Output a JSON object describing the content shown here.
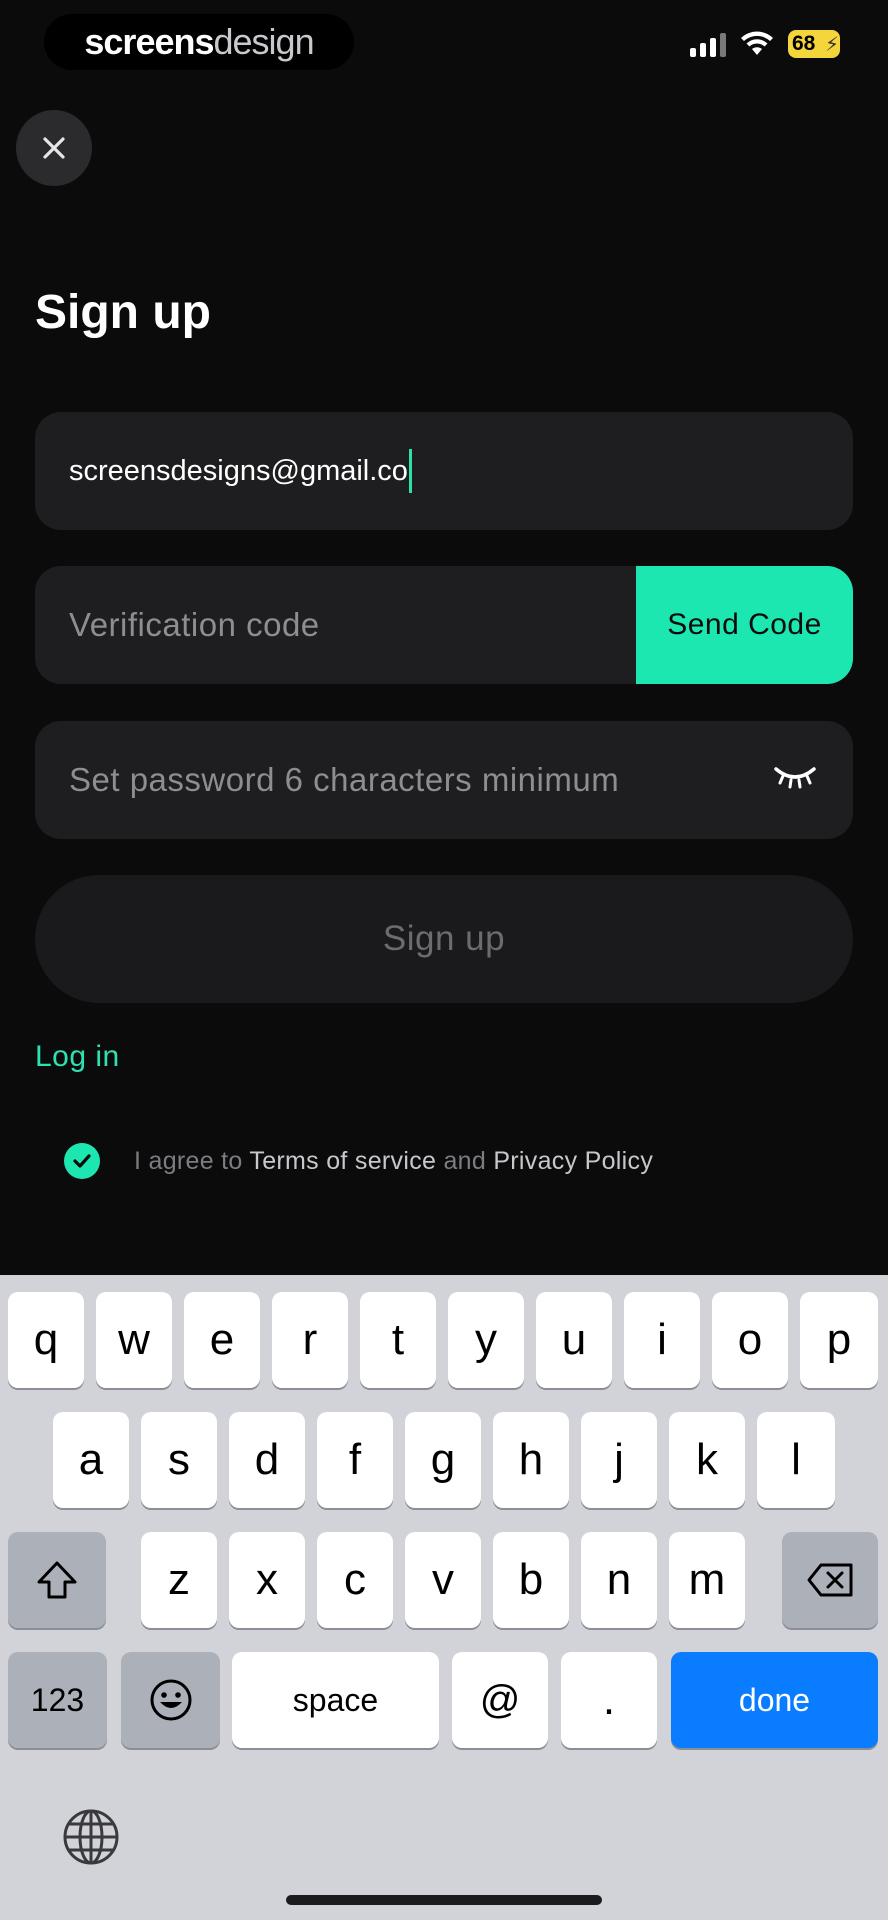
{
  "status_bar": {
    "brand_part1": "screens",
    "brand_part2": "design",
    "battery": "68"
  },
  "header": {
    "title": "Sign up",
    "close_icon": "close-icon"
  },
  "form": {
    "email_value": "screensdesigns@gmail.co",
    "verification_placeholder": "Verification code",
    "send_code_label": "Send Code",
    "password_placeholder": "Set password 6 characters minimum",
    "password_toggle_icon": "eye-closed-icon",
    "submit_label": "Sign up"
  },
  "login_link": "Log in",
  "agreement": {
    "checked": true,
    "prefix": "I agree to ",
    "terms": "Terms of service",
    "and": " and ",
    "privacy": "Privacy Policy"
  },
  "keyboard": {
    "row1": [
      "q",
      "w",
      "e",
      "r",
      "t",
      "y",
      "u",
      "i",
      "o",
      "p"
    ],
    "row2": [
      "a",
      "s",
      "d",
      "f",
      "g",
      "h",
      "j",
      "k",
      "l"
    ],
    "row3": [
      "z",
      "x",
      "c",
      "v",
      "b",
      "n",
      "m"
    ],
    "numbers_label": "123",
    "space_label": "space",
    "at_label": "@",
    "dot_label": ".",
    "done_label": "done"
  },
  "colors": {
    "accent": "#1de7b0",
    "background": "#0b0b0c",
    "field": "#1e1e20",
    "done_blue": "#0a7cff"
  }
}
